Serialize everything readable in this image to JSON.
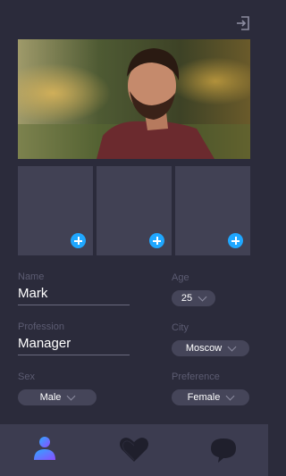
{
  "header": {
    "logout_icon": "logout-icon"
  },
  "profile": {
    "photo_icon": "profile-photo",
    "add_icon": "plus-icon",
    "photos_empty_count": 3
  },
  "form": {
    "name_label": "Name",
    "name_value": "Mark",
    "age_label": "Age",
    "age_value": "25",
    "profession_label": "Profession",
    "profession_value": "Manager",
    "city_label": "City",
    "city_value": "Moscow",
    "sex_label": "Sex",
    "sex_value": "Male",
    "preference_label": "Preference",
    "preference_value": "Female"
  },
  "nav": {
    "items": [
      {
        "icon": "profile-icon",
        "active": true
      },
      {
        "icon": "heart-icon",
        "active": false
      },
      {
        "icon": "chat-bubble-icon",
        "active": false
      }
    ]
  },
  "colors": {
    "background": "#2b2b3b",
    "accent_blue": "#1fa7ff",
    "accent_purple": "#8a4dff",
    "pill": "#454559",
    "navbar": "#3c3c50"
  }
}
